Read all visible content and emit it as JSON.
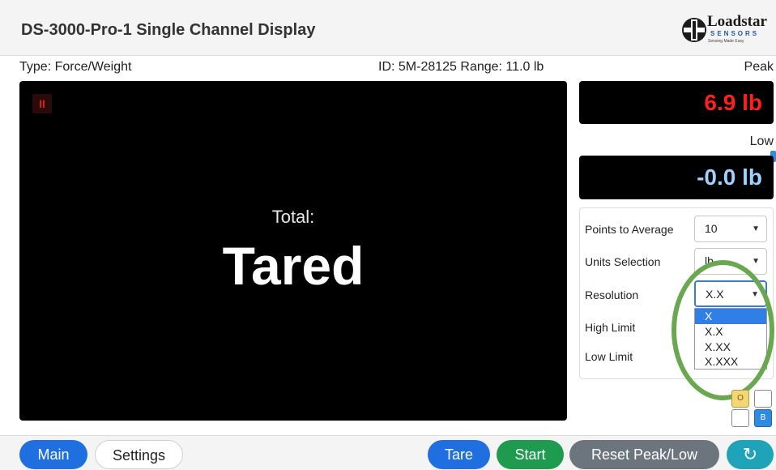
{
  "header": {
    "title": "DS-3000-Pro-1 Single Channel Display"
  },
  "logo": {
    "word": "Loadstar",
    "sensors": "SENSORS",
    "tagline": "Sensing Made Easy"
  },
  "info": {
    "type": "Type: Force/Weight",
    "id_range": "ID: 5M-28125 Range: 11.0 lb"
  },
  "display": {
    "pause_glyph": "II",
    "total_label": "Total:",
    "value": "Tared"
  },
  "readouts": {
    "peak_label": "Peak",
    "peak_value": "6.9 lb",
    "low_label": "Low",
    "low_value": "-0.0 lb"
  },
  "settings": {
    "points_label": "Points to Average",
    "points_value": "10",
    "units_label": "Units Selection",
    "units_value": "lb",
    "resolution_label": "Resolution",
    "resolution_value": "X.X",
    "high_limit_label": "High Limit",
    "low_limit_label": "Low Limit",
    "resolution_options": [
      "X",
      "X.X",
      "X.XX",
      "X.XXX"
    ],
    "highlighted_option": "X"
  },
  "mini_buttons": {
    "o": "O",
    "b": "B"
  },
  "footer": {
    "main": "Main",
    "settings": "Settings",
    "tare": "Tare",
    "start": "Start",
    "reset": "Reset Peak/Low"
  },
  "colors": {
    "peak": "#ff1f1f",
    "low": "#9fd0ff",
    "primary": "#1f6fe0",
    "start": "#1e9b4f",
    "highlight_circle": "#6aa84f"
  }
}
